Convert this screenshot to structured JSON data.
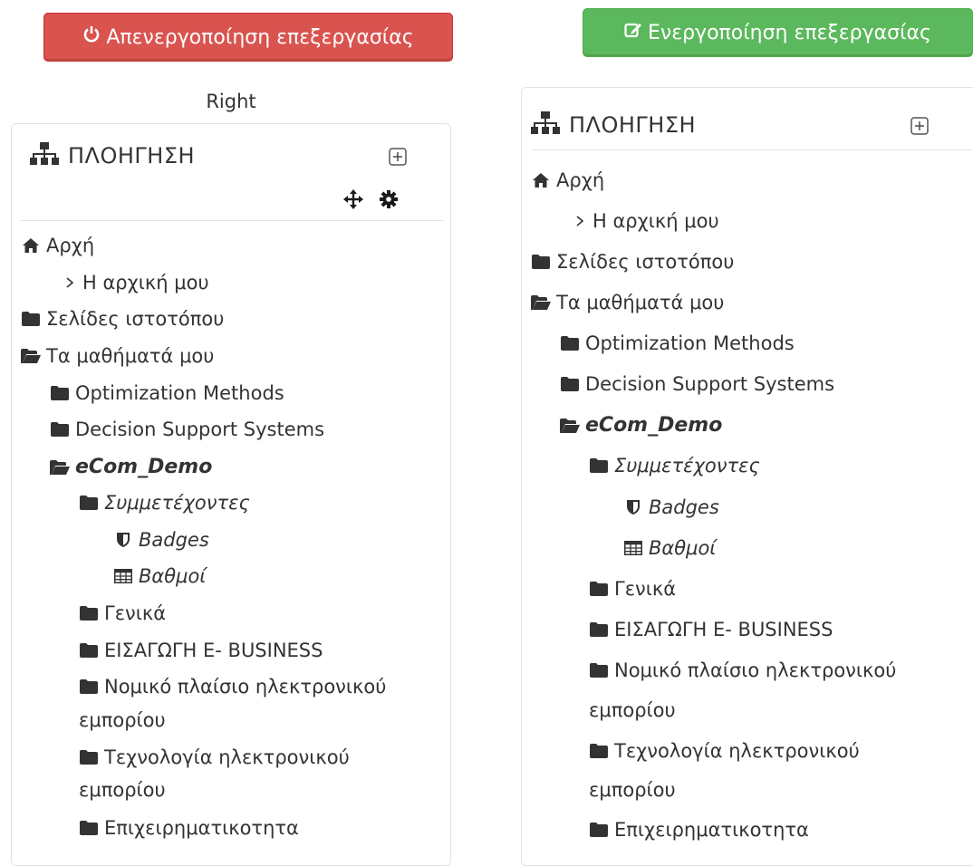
{
  "buttons": {
    "disable_editing": "Απενεργοποίηση επεξεργασίας",
    "enable_editing": "Ενεργοποίηση επεξεργασίας",
    "disable_color": "#d9534f",
    "enable_color": "#5cb85c"
  },
  "region_label": "Right",
  "block": {
    "title": "ΠΛΟΗΓΗΣΗ",
    "home": "Αρχή",
    "my_home": "Η αρχική μου",
    "site_pages": "Σελίδες ιστοτόπου",
    "my_courses": "Τα μαθήματά μου",
    "courses": [
      "Optimization Methods",
      "Decision Support Systems"
    ],
    "current_course": "eCom_Demo",
    "participants": "Συμμετέχοντες",
    "badges": "Badges",
    "grades": "Βαθμοί",
    "sections": {
      "general": "Γενικά",
      "intro": "ΕΙΣΑΓΩΓΗ Ε- BUSINESS",
      "legal_line1": "Νομικό πλαίσιο ηλεκτρονικού",
      "legal_line2": "εμπορίου",
      "tech_line1": "Τεχνολογία ηλεκτρονικού",
      "tech_line2": "εμπορίου",
      "business": "Επιχειρηματικοτητα"
    }
  },
  "icons": {
    "block_icon": "sitemap-icon",
    "home_icon": "home-icon",
    "folder_icon": "folder-icon",
    "folder_open_icon": "folder-open-icon",
    "badge_icon": "shield-icon",
    "grades_icon": "table-icon",
    "move_icon": "move-icon",
    "config_icon": "gear-icon",
    "dock_icon": "expand-icon"
  }
}
